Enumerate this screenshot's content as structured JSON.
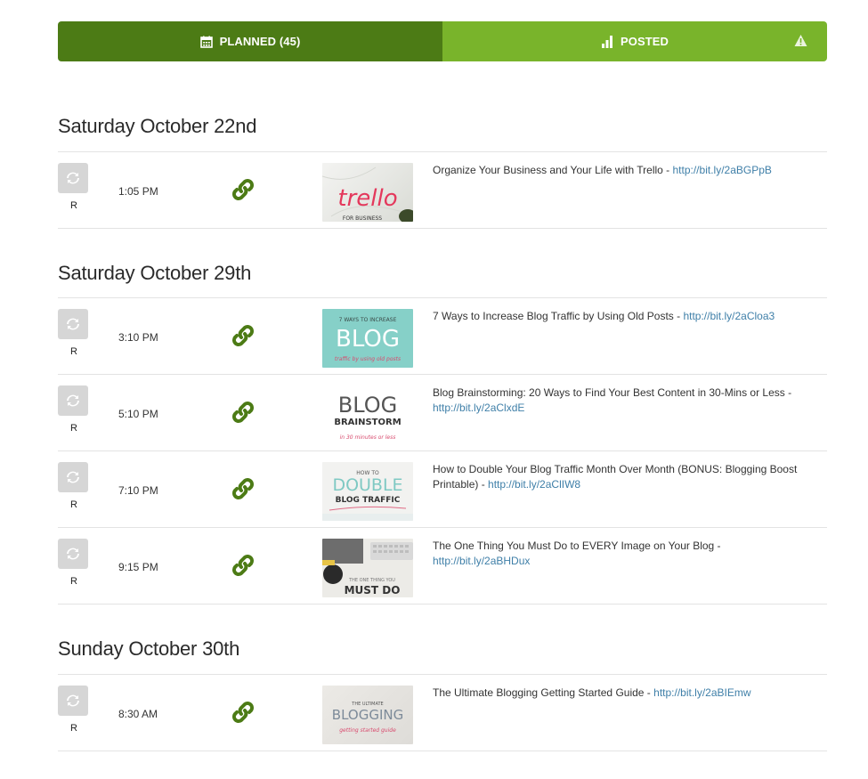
{
  "tabs": {
    "planned_label": "PLANNED (45)",
    "posted_label": "POSTED",
    "planned_icon": "calendar-icon",
    "posted_icon": "bar-chart-icon",
    "warning_icon": "warning-icon",
    "planned_color": "#4c7b15",
    "posted_color": "#79b42b"
  },
  "days": [
    {
      "heading": "Saturday October 22nd",
      "posts": [
        {
          "avatar_letter": "R",
          "time": "1:05 PM",
          "title": "Organize Your Business and Your Life with Trello - ",
          "url": "http://bit.ly/2aBGPpB",
          "thumb": {
            "line1": "trello",
            "line2": "FOR BUSINESS"
          }
        }
      ]
    },
    {
      "heading": "Saturday October 29th",
      "posts": [
        {
          "avatar_letter": "R",
          "time": "3:10 PM",
          "title": "7 Ways to Increase Blog Traffic by Using Old Posts - ",
          "url": "http://bit.ly/2aCloa3",
          "thumb": {
            "line1": "7 WAYS TO INCREASE",
            "line2": "BLOG",
            "line3": "traffic by using old posts"
          }
        },
        {
          "avatar_letter": "R",
          "time": "5:10 PM",
          "title": "Blog Brainstorming: 20 Ways to Find Your Best Content in 30-Mins or Less - ",
          "url": "http://bit.ly/2aClxdE",
          "thumb": {
            "line1": "BLOG",
            "line2": "BRAINSTORM",
            "line3": "in 30 minutes or less"
          }
        },
        {
          "avatar_letter": "R",
          "time": "7:10 PM",
          "title": "How to Double Your Blog Traffic Month Over Month (BONUS: Blogging Boost Printable) - ",
          "url": "http://bit.ly/2aClIW8",
          "thumb": {
            "line1": "HOW TO",
            "line2": "DOUBLE",
            "line3": "BLOG TRAFFIC"
          }
        },
        {
          "avatar_letter": "R",
          "time": "9:15 PM",
          "title": "The One Thing You Must Do to EVERY Image on Your Blog - ",
          "url": "http://bit.ly/2aBHDux",
          "thumb": {
            "line1": "THE ONE THING YOU",
            "line2": "MUST DO"
          }
        }
      ]
    },
    {
      "heading": "Sunday October 30th",
      "posts": [
        {
          "avatar_letter": "R",
          "time": "8:30 AM",
          "title": "The Ultimate Blogging Getting Started Guide - ",
          "url": "http://bit.ly/2aBIEmw",
          "thumb": {
            "line1": "THE ULTIMATE",
            "line2": "BLOGGING",
            "line3": "getting started guide"
          }
        }
      ]
    }
  ]
}
